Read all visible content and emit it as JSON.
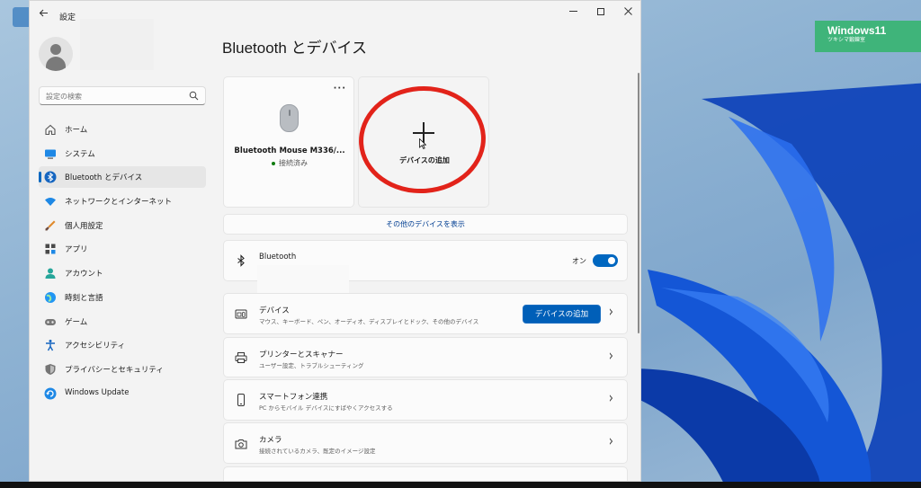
{
  "window": {
    "app_title": "設定",
    "back_icon": "arrow-left-icon",
    "controls": [
      "minimize-icon",
      "maximize-icon",
      "close-icon"
    ]
  },
  "watermark": {
    "title": "Windows11",
    "subtitle": "ツキシマ鍛錬室"
  },
  "sidebar": {
    "search_placeholder": "設定の検索",
    "items": [
      {
        "label": "ホーム",
        "icon": "home-icon",
        "active": false
      },
      {
        "label": "システム",
        "icon": "system-icon",
        "active": false
      },
      {
        "label": "Bluetooth とデバイス",
        "icon": "bluetooth-icon",
        "active": true
      },
      {
        "label": "ネットワークとインターネット",
        "icon": "wifi-icon",
        "active": false
      },
      {
        "label": "個人用設定",
        "icon": "brush-icon",
        "active": false
      },
      {
        "label": "アプリ",
        "icon": "apps-icon",
        "active": false
      },
      {
        "label": "アカウント",
        "icon": "account-icon",
        "active": false
      },
      {
        "label": "時刻と言語",
        "icon": "globe-icon",
        "active": false
      },
      {
        "label": "ゲーム",
        "icon": "gamepad-icon",
        "active": false
      },
      {
        "label": "アクセシビリティ",
        "icon": "accessibility-icon",
        "active": false
      },
      {
        "label": "プライバシーとセキュリティ",
        "icon": "shield-icon",
        "active": false
      },
      {
        "label": "Windows Update",
        "icon": "update-icon",
        "active": false
      }
    ]
  },
  "main": {
    "title": "Bluetooth とデバイス",
    "device_card": {
      "name": "Bluetooth Mouse M336/...",
      "status": "接続済み",
      "more": "···"
    },
    "add_card": {
      "label": "デバイスの追加"
    },
    "show_more": "その他のデバイスを表示",
    "bluetooth_row": {
      "title": "Bluetooth",
      "toggle_label": "オン",
      "toggle_on": true
    },
    "rows": [
      {
        "title": "デバイス",
        "sub": "マウス、キーボード、ペン、オーディオ、ディスプレイとドック、その他のデバイス",
        "button": "デバイスの追加",
        "icon": "devices-icon"
      },
      {
        "title": "プリンターとスキャナー",
        "sub": "ユーザー設定、トラブルシューティング",
        "icon": "printer-icon"
      },
      {
        "title": "スマートフォン連携",
        "sub": "PC からモバイル デバイスにすばやくアクセスする",
        "icon": "phone-icon"
      },
      {
        "title": "カメラ",
        "sub": "接続されているカメラ、既定のイメージ設定",
        "icon": "camera-icon"
      }
    ],
    "chevron": "›"
  },
  "colors": {
    "accent": "#0067c0",
    "annotation": "#e2231a",
    "watermark": "#3fb47a"
  }
}
